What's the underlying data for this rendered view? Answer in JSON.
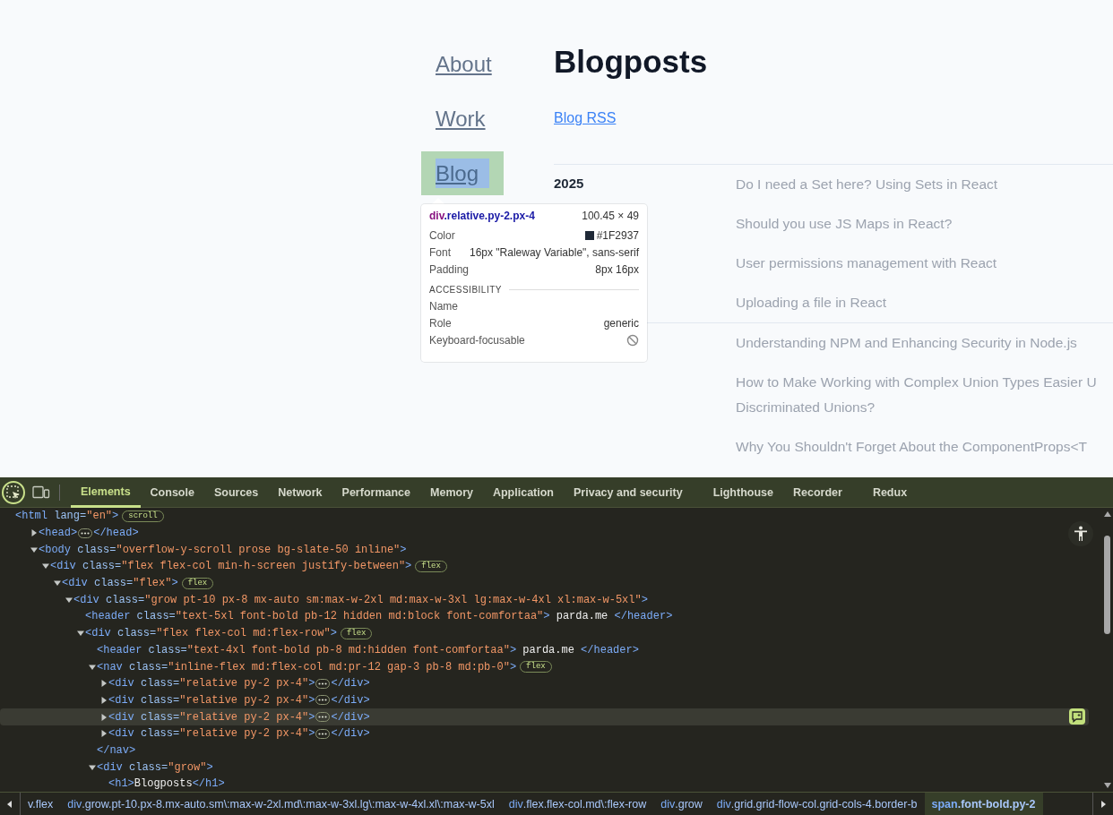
{
  "nav": [
    {
      "label": "About",
      "inspected": false
    },
    {
      "label": "Work",
      "inspected": false
    },
    {
      "label": "Blog",
      "inspected": true
    }
  ],
  "heading": "Blogposts",
  "rss_link": "Blog RSS",
  "year_groups": [
    {
      "year": "2025",
      "posts": [
        {
          "lines": [
            "Do I need a Set here? Using Sets in React"
          ]
        },
        {
          "lines": [
            "Should you use JS Maps in React?"
          ]
        },
        {
          "lines": [
            "User permissions management with React"
          ]
        },
        {
          "lines": [
            "Uploading a file in React"
          ]
        }
      ]
    },
    {
      "posts": [
        {
          "lines": [
            "Understanding NPM and Enhancing Security in Node.js"
          ]
        },
        {
          "lines": [
            "How to Make Working with Complex Union Types Easier U",
            "Discriminated Unions?"
          ]
        },
        {
          "lines": [
            "Why You Shouldn't Forget About the ComponentProps<T"
          ]
        }
      ]
    }
  ],
  "tooltip": {
    "tag": "div",
    "classes": ".relative.py-2.px-4",
    "size": "100.45 × 49",
    "properties": [
      {
        "label": "Color",
        "value": "#1F2937",
        "kind": "color"
      },
      {
        "label": "Font",
        "value": "16px \"Raleway Variable\", sans-serif",
        "kind": "text"
      },
      {
        "label": "Padding",
        "value": "8px 16px",
        "kind": "text"
      }
    ],
    "section_title": "ACCESSIBILITY",
    "accessibility": [
      {
        "label": "Name",
        "kind": "text"
      },
      {
        "label": "Role",
        "value": "generic",
        "kind": "text"
      },
      {
        "label": "Keyboard-focusable",
        "kind": "not-allowed"
      }
    ]
  },
  "devtools": {
    "inspect_active": true,
    "tabs": [
      {
        "label": "Elements",
        "selected": true
      },
      {
        "label": "Console",
        "selected": false
      },
      {
        "label": "Sources",
        "selected": false
      },
      {
        "label": "Network",
        "selected": false
      },
      {
        "label": "Performance",
        "selected": false
      },
      {
        "label": "Memory",
        "selected": false
      },
      {
        "label": "Application",
        "selected": false
      },
      {
        "label": "Privacy and security",
        "selected": false
      },
      {
        "label": "Lighthouse",
        "selected": false
      },
      {
        "label": "Recorder",
        "selected": false
      },
      {
        "label": "Redux",
        "selected": false
      }
    ],
    "dom_tree": [
      {
        "selected": false,
        "tokens": [
          {
            "kind": "tag",
            "text": "<html "
          },
          {
            "kind": "attr",
            "text": "lang="
          },
          {
            "kind": "val",
            "text": "\"en\""
          },
          {
            "kind": "tag",
            "text": ">"
          },
          {
            "kind": "badge",
            "text": "scroll"
          }
        ],
        "children": [
          {
            "selected": false,
            "expanded": false,
            "tokens": [
              {
                "kind": "tag",
                "text": "<head>"
              },
              {
                "kind": "ellipsis"
              },
              {
                "kind": "tag",
                "text": "</head>"
              }
            ]
          },
          {
            "selected": false,
            "expanded": true,
            "tokens": [
              {
                "kind": "tag",
                "text": "<body "
              },
              {
                "kind": "attr",
                "text": "class="
              },
              {
                "kind": "val",
                "text": "\"overflow-y-scroll prose bg-slate-50 inline\""
              },
              {
                "kind": "tag",
                "text": ">"
              }
            ],
            "children": [
              {
                "selected": false,
                "expanded": true,
                "tokens": [
                  {
                    "kind": "tag",
                    "text": "<div "
                  },
                  {
                    "kind": "attr",
                    "text": "class="
                  },
                  {
                    "kind": "val",
                    "text": "\"flex flex-col min-h-screen justify-between\""
                  },
                  {
                    "kind": "tag",
                    "text": ">"
                  },
                  {
                    "kind": "badge",
                    "text": "flex"
                  }
                ],
                "children": [
                  {
                    "selected": false,
                    "expanded": true,
                    "tokens": [
                      {
                        "kind": "tag",
                        "text": "<div "
                      },
                      {
                        "kind": "attr",
                        "text": "class="
                      },
                      {
                        "kind": "val",
                        "text": "\"flex\""
                      },
                      {
                        "kind": "tag",
                        "text": ">"
                      },
                      {
                        "kind": "badge",
                        "text": "flex"
                      }
                    ],
                    "children": [
                      {
                        "selected": false,
                        "expanded": true,
                        "tokens": [
                          {
                            "kind": "tag",
                            "text": "<div "
                          },
                          {
                            "kind": "attr",
                            "text": "class="
                          },
                          {
                            "kind": "val",
                            "text": "\"grow pt-10 px-8 mx-auto sm:max-w-2xl md:max-w-3xl lg:max-w-4xl xl:max-w-5xl\""
                          },
                          {
                            "kind": "tag",
                            "text": ">"
                          }
                        ],
                        "children": [
                          {
                            "selected": false,
                            "tokens": [
                              {
                                "kind": "tag",
                                "text": "<header "
                              },
                              {
                                "kind": "attr",
                                "text": "class="
                              },
                              {
                                "kind": "val",
                                "text": "\"text-5xl font-bold pb-12 hidden md:block font-comfortaa\""
                              },
                              {
                                "kind": "tag",
                                "text": ">"
                              },
                              {
                                "kind": "text",
                                "text": " parda.me "
                              },
                              {
                                "kind": "tag",
                                "text": "</header>"
                              }
                            ]
                          },
                          {
                            "selected": false,
                            "expanded": true,
                            "tokens": [
                              {
                                "kind": "tag",
                                "text": "<div "
                              },
                              {
                                "kind": "attr",
                                "text": "class="
                              },
                              {
                                "kind": "val",
                                "text": "\"flex flex-col md:flex-row\""
                              },
                              {
                                "kind": "tag",
                                "text": ">"
                              },
                              {
                                "kind": "badge",
                                "text": "flex"
                              }
                            ],
                            "children": [
                              {
                                "selected": false,
                                "tokens": [
                                  {
                                    "kind": "tag",
                                    "text": "<header "
                                  },
                                  {
                                    "kind": "attr",
                                    "text": "class="
                                  },
                                  {
                                    "kind": "val",
                                    "text": "\"text-4xl font-bold pb-8 md:hidden font-comfortaa\""
                                  },
                                  {
                                    "kind": "tag",
                                    "text": ">"
                                  },
                                  {
                                    "kind": "text",
                                    "text": " parda.me "
                                  },
                                  {
                                    "kind": "tag",
                                    "text": "</header>"
                                  }
                                ]
                              },
                              {
                                "selected": false,
                                "expanded": true,
                                "tokens": [
                                  {
                                    "kind": "tag",
                                    "text": "<nav "
                                  },
                                  {
                                    "kind": "attr",
                                    "text": "class="
                                  },
                                  {
                                    "kind": "val",
                                    "text": "\"inline-flex md:flex-col md:pr-12 gap-3 pb-8 md:pb-0\""
                                  },
                                  {
                                    "kind": "tag",
                                    "text": ">"
                                  },
                                  {
                                    "kind": "badge",
                                    "text": "flex"
                                  }
                                ],
                                "closing": [
                                  {
                                    "kind": "tag",
                                    "text": "</nav>"
                                  }
                                ],
                                "children": [
                                  {
                                    "selected": false,
                                    "expanded": false,
                                    "tokens": [
                                      {
                                        "kind": "tag",
                                        "text": "<div "
                                      },
                                      {
                                        "kind": "attr",
                                        "text": "class="
                                      },
                                      {
                                        "kind": "val",
                                        "text": "\"relative py-2 px-4\""
                                      },
                                      {
                                        "kind": "tag",
                                        "text": ">"
                                      },
                                      {
                                        "kind": "ellipsis"
                                      },
                                      {
                                        "kind": "tag",
                                        "text": "</div>"
                                      }
                                    ]
                                  },
                                  {
                                    "selected": false,
                                    "expanded": false,
                                    "tokens": [
                                      {
                                        "kind": "tag",
                                        "text": "<div "
                                      },
                                      {
                                        "kind": "attr",
                                        "text": "class="
                                      },
                                      {
                                        "kind": "val",
                                        "text": "\"relative py-2 px-4\""
                                      },
                                      {
                                        "kind": "tag",
                                        "text": ">"
                                      },
                                      {
                                        "kind": "ellipsis"
                                      },
                                      {
                                        "kind": "tag",
                                        "text": "</div>"
                                      }
                                    ]
                                  },
                                  {
                                    "selected": true,
                                    "expanded": false,
                                    "tokens": [
                                      {
                                        "kind": "tag",
                                        "text": "<div "
                                      },
                                      {
                                        "kind": "attr",
                                        "text": "class="
                                      },
                                      {
                                        "kind": "val",
                                        "text": "\"relative py-2 px-4\""
                                      },
                                      {
                                        "kind": "tag",
                                        "text": ">"
                                      },
                                      {
                                        "kind": "ellipsis"
                                      },
                                      {
                                        "kind": "tag",
                                        "text": "</div>"
                                      }
                                    ]
                                  },
                                  {
                                    "selected": false,
                                    "expanded": false,
                                    "tokens": [
                                      {
                                        "kind": "tag",
                                        "text": "<div "
                                      },
                                      {
                                        "kind": "attr",
                                        "text": "class="
                                      },
                                      {
                                        "kind": "val",
                                        "text": "\"relative py-2 px-4\""
                                      },
                                      {
                                        "kind": "tag",
                                        "text": ">"
                                      },
                                      {
                                        "kind": "ellipsis"
                                      },
                                      {
                                        "kind": "tag",
                                        "text": "</div>"
                                      }
                                    ]
                                  }
                                ]
                              },
                              {
                                "selected": false,
                                "expanded": true,
                                "tokens": [
                                  {
                                    "kind": "tag",
                                    "text": "<div "
                                  },
                                  {
                                    "kind": "attr",
                                    "text": "class="
                                  },
                                  {
                                    "kind": "val",
                                    "text": "\"grow\""
                                  },
                                  {
                                    "kind": "tag",
                                    "text": ">"
                                  }
                                ],
                                "children": [
                                  {
                                    "selected": false,
                                    "tokens": [
                                      {
                                        "kind": "tag",
                                        "text": "<h1>"
                                      },
                                      {
                                        "kind": "text",
                                        "text": "Blogposts"
                                      },
                                      {
                                        "kind": "tag",
                                        "text": "</h1>"
                                      }
                                    ]
                                  }
                                ]
                              }
                            ]
                          }
                        ]
                      }
                    ]
                  }
                ]
              }
            ]
          }
        ]
      }
    ],
    "breadcrumbs": [
      {
        "classes": "v.flex",
        "selected": false
      },
      {
        "tag": "div",
        "classes": ".grow.pt-10.px-8.mx-auto.sm\\:max-w-2xl.md\\:max-w-3xl.lg\\:max-w-4xl.xl\\:max-w-5xl",
        "selected": false
      },
      {
        "tag": "div",
        "classes": ".flex.flex-col.md\\:flex-row",
        "selected": false
      },
      {
        "tag": "div",
        "classes": ".grow",
        "selected": false
      },
      {
        "tag": "div",
        "classes": ".grid.grid-flow-col.grid-cols-4.border-b",
        "selected": false
      },
      {
        "tag": "span",
        "classes": ".font-bold.py-2",
        "selected": true
      }
    ]
  }
}
